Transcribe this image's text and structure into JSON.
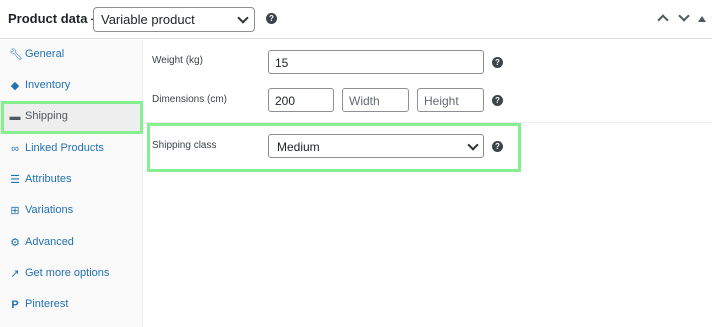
{
  "header": {
    "title": "Product data —",
    "product_type": "Variable product"
  },
  "sidebar": {
    "items": [
      {
        "label": "General",
        "icon": "wrench-icon"
      },
      {
        "label": "Inventory",
        "icon": "tag-icon"
      },
      {
        "label": "Shipping",
        "icon": "truck-icon",
        "active": true
      },
      {
        "label": "Linked Products",
        "icon": "link-icon"
      },
      {
        "label": "Attributes",
        "icon": "list-icon"
      },
      {
        "label": "Variations",
        "icon": "grid-icon"
      },
      {
        "label": "Advanced",
        "icon": "gear-icon"
      },
      {
        "label": "Get more options",
        "icon": "plugin-icon"
      },
      {
        "label": "Pinterest",
        "icon": "pinterest-icon"
      }
    ]
  },
  "shipping": {
    "weight_label": "Weight (kg)",
    "weight_value": "15",
    "dimensions_label": "Dimensions (cm)",
    "length_value": "200",
    "width_placeholder": "Width",
    "height_placeholder": "Height",
    "class_label": "Shipping class",
    "class_value": "Medium"
  },
  "help_glyph": "?",
  "colors": {
    "highlight": "#86ef8f",
    "link": "#2271b1",
    "active_bg": "#eeeeee"
  }
}
